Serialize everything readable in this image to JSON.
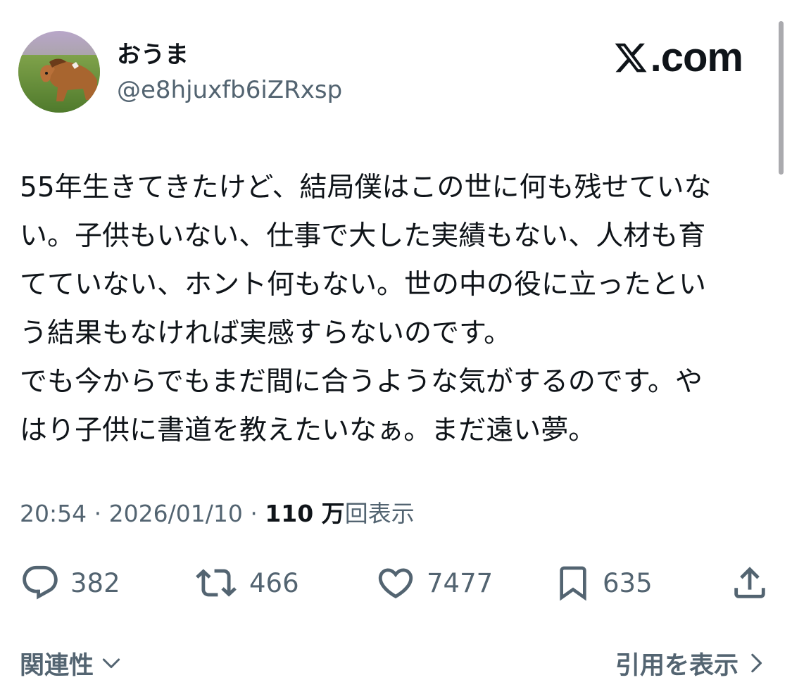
{
  "author": {
    "display_name": "おうま",
    "handle": "@e8hjuxfb6iZRxsp",
    "avatar": "pony-in-field-photo"
  },
  "brand": {
    "label": ".com",
    "icon": "x-logo-icon"
  },
  "post": {
    "lines": [
      "55年生きてきたけど、結局僕はこの世に何も残せていな",
      "い。子供もいない、仕事で大した実績もない、人材も育",
      "てていない、ホント何もない。世の中の役に立ったとい",
      "う結果もなければ実感すらないのです。",
      "でも今からでもまだ間に合うような気がするのです。や",
      "はり子供に書道を教えたいなぁ。まだ遠い夢。"
    ]
  },
  "meta": {
    "time": "20:54",
    "separator": "·",
    "date": "2026/01/10",
    "views_count": "110 万",
    "views_label": "回表示"
  },
  "actions": {
    "replies": "382",
    "reposts": "466",
    "likes": "7477",
    "bookmarks": "635"
  },
  "footer": {
    "related_label": "関連性",
    "quotes_label": "引用を表示"
  },
  "colors": {
    "text_primary": "#0f1419",
    "text_secondary": "#536471",
    "background": "#ffffff"
  }
}
